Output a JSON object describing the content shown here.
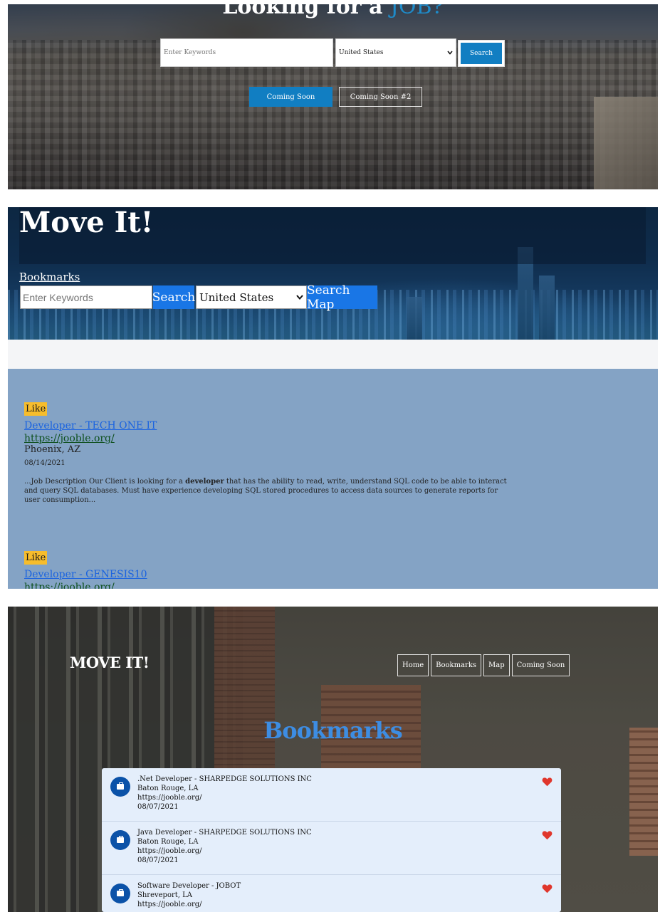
{
  "panel1": {
    "title_main": "Looking for a ",
    "title_accent": "JOB?",
    "keywords_placeholder": "Enter Keywords",
    "country_value": "United States",
    "search_label": "Search",
    "coming_soon_label": "Coming Soon",
    "coming_soon2_label": "Coming Soon #2"
  },
  "panel2": {
    "title": "Move It!",
    "bookmarks_link": "Bookmarks",
    "keywords_placeholder": "Enter Keywords",
    "search_label": "Search",
    "country_value": "United States",
    "search_map_label": "Search Map",
    "results": [
      {
        "like_label": "Like",
        "title": "Developer - TECH ONE IT",
        "url": "https://jooble.org/",
        "location": "Phoenix, AZ",
        "date": "08/14/2021",
        "desc_before": "...Job Description Our Client is looking for a ",
        "desc_bold": "developer",
        "desc_after": " that has the ability to read, write, understand SQL code to be able to interact and query SQL databases. Must have experience developing SQL stored procedures to access data sources to generate reports for user consumption..."
      },
      {
        "like_label": "Like",
        "title": "Developer - GENESIS10",
        "url": "https://jooble.org/"
      }
    ]
  },
  "panel3": {
    "logo": "MOVE IT!",
    "nav": [
      "Home",
      "Bookmarks",
      "Map",
      "Coming Soon"
    ],
    "heading": "Bookmarks",
    "bookmarks": [
      {
        "title": ".Net Developer - SHARPEDGE SOLUTIONS INC",
        "location": "Baton Rouge, LA",
        "url": "https://jooble.org/",
        "date": "08/07/2021"
      },
      {
        "title": "Java Developer - SHARPEDGE SOLUTIONS INC",
        "location": "Baton Rouge, LA",
        "url": "https://jooble.org/",
        "date": "08/07/2021"
      },
      {
        "title": "Software Developer - JOBOT",
        "location": "Shreveport, LA",
        "url": "https://jooble.org/",
        "date": ""
      }
    ],
    "heart_color": "#e0362c",
    "avatar_icon": "briefcase-icon"
  }
}
